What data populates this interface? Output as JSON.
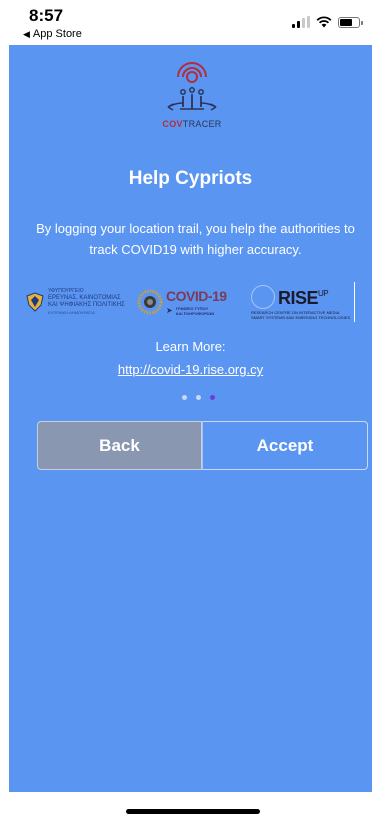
{
  "status_bar": {
    "time": "8:57",
    "back_app": "App Store",
    "back_icon": "triangle-left-icon",
    "signal_icon": "cellular-signal-icon",
    "wifi_icon": "wifi-icon",
    "battery_icon": "battery-icon"
  },
  "app": {
    "logo": {
      "prefix": "COV",
      "suffix": "TRACER",
      "icon": "covtracer-people-signal-icon"
    },
    "title": "Help Cypriots",
    "description": "By logging your location trail, you help the authorities to track COVID19 with higher accuracy.",
    "partners": {
      "ministry": {
        "line1": "ΥΦΥΠΟΥΡΓΕΙΟ",
        "line2": "ΕΡΕΥΝΑΣ, ΚΑΙΝΟΤΟΜΙΑΣ",
        "line3": "ΚΑΙ ΨΗΦΙΑΚΗΣ ΠΟΛΙΤΙΚΗΣ",
        "line4": "ΚΥΠΡΙΑΚΗ ΔΗΜΟΚΡΑΤΙΑ"
      },
      "covid": {
        "title": "COVID-19",
        "sub1": "ΓΡΑΦΕΙΟ ΤΥΠΟΥ",
        "sub2": "ΚΑΙ ΠΛΗΡΟΦΟΡΙΩΝ"
      },
      "rise": {
        "word": "RISE",
        "sup": "UP",
        "sub1": "RESEARCH CENTRE ON INTERACTIVE MEDIA",
        "sub2": "SMART SYSTEMS AND EMERGING TECHNOLOGIES"
      }
    },
    "learn_more": "Learn More:",
    "link": "http://covid-19.rise.org.cy",
    "pager": {
      "count": 3,
      "active_index": 2
    },
    "buttons": {
      "back": "Back",
      "accept": "Accept"
    }
  },
  "colors": {
    "background": "#5b95f2",
    "back_button": "#8997b0",
    "active_dot": "#6a3fd8",
    "inactive_dot": "#c8d9f8",
    "logo_red": "#b32d3a",
    "logo_navy": "#2a3556"
  }
}
